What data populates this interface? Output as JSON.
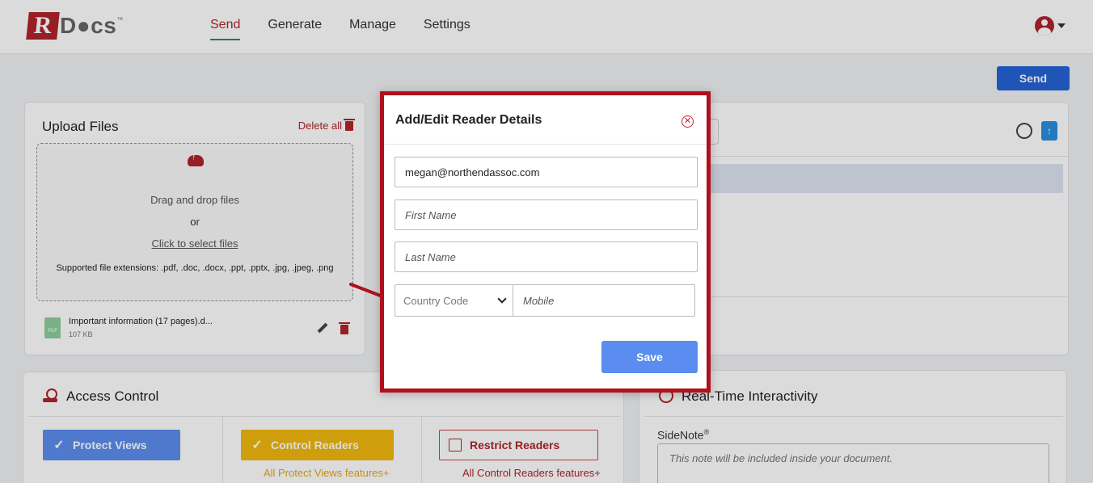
{
  "header": {
    "logo_r": "R",
    "logo_text": "D●cs",
    "logo_tm": "™",
    "nav": [
      "Send",
      "Generate",
      "Manage",
      "Settings"
    ]
  },
  "actions": {
    "send_label": "Send"
  },
  "upload": {
    "title": "Upload Files",
    "delete_all": "Delete all",
    "drag_text": "Drag and drop files",
    "or_text": "or",
    "select_link": "Click to select files",
    "extensions": "Supported file extensions: .pdf, .doc, .docx, .ppt, .pptx, .jpg, .jpeg, .png",
    "file": {
      "name": "Important information (17 pages).d...",
      "size": "107 KB",
      "type_label": "PDF"
    }
  },
  "access": {
    "title": "Access Control",
    "options": [
      {
        "label": "Protect Views",
        "checked": true
      },
      {
        "label": "Control Readers",
        "checked": true
      },
      {
        "label": "Restrict Readers",
        "checked": false
      }
    ],
    "feature_notes": [
      "All Protect Views features+",
      "All Control Readers features+"
    ]
  },
  "realtime": {
    "title": "Real-Time Interactivity",
    "sidenote_label": "SideNote",
    "sidenote_marker": "®",
    "sidenote_placeholder": "This note will be included inside your document."
  },
  "modal": {
    "title": "Add/Edit Reader Details",
    "email_value": "megan@northendassoc.com",
    "first_name_placeholder": "First Name",
    "last_name_placeholder": "Last Name",
    "country_code_placeholder": "Country Code",
    "mobile_placeholder": "Mobile",
    "save_label": "Save"
  },
  "colors": {
    "brand_red": "#b0232a",
    "primary_blue": "#2563d6",
    "protect_blue": "#5b8def",
    "control_yellow": "#f2b90f",
    "highlight_border": "#b0101b"
  },
  "icons": [
    "user-avatar-icon",
    "chevron-down-icon",
    "trash-icon",
    "cloud-upload-icon",
    "pdf-file-icon",
    "pencil-icon",
    "check-icon",
    "close-circle-icon",
    "clock-icon",
    "user-edit-icon",
    "upload-file-icon",
    "hand-user-icon",
    "arrow-pointer-icon"
  ]
}
